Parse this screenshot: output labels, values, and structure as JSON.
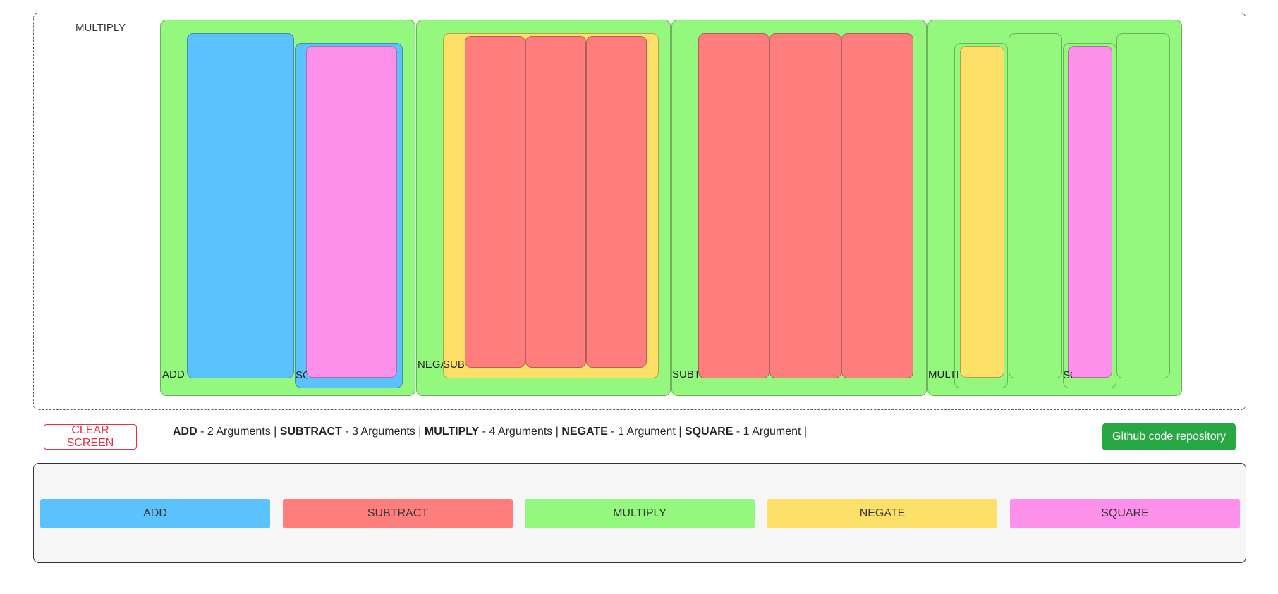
{
  "workspace": {
    "root_label": "MULTIPLY",
    "labels": {
      "add": "ADD",
      "square": "SQUARE",
      "negate": "NEGATE",
      "subtract": "SUBTRACT",
      "multiply": "MULTIPLY"
    }
  },
  "toolbar": {
    "clear_label": "CLEAR SCREEN",
    "github_label": "Github code repository",
    "legend": [
      {
        "op": "ADD",
        "desc": " - 2 Arguments |"
      },
      {
        "op": "SUBTRACT",
        "desc": " - 3 Arguments |"
      },
      {
        "op": "MULTIPLY",
        "desc": " - 4 Arguments |"
      },
      {
        "op": "NEGATE",
        "desc": " - 1 Argument |"
      },
      {
        "op": "SQUARE",
        "desc": " - 1 Argument |"
      }
    ]
  },
  "palette": {
    "buttons": [
      {
        "label": "ADD",
        "color": "#5bc2fe"
      },
      {
        "label": "SUBTRACT",
        "color": "#fe7e7e"
      },
      {
        "label": "MULTIPLY",
        "color": "#94f77e"
      },
      {
        "label": "NEGATE",
        "color": "#fde068"
      },
      {
        "label": "SQUARE",
        "color": "#fd90ea"
      }
    ]
  },
  "colors": {
    "add": "#5bc2fe",
    "subtract": "#fe7e7e",
    "multiply": "#94f77e",
    "negate": "#fde068",
    "square": "#fd90ea",
    "clear": "#dc3545",
    "github": "#28a745"
  }
}
